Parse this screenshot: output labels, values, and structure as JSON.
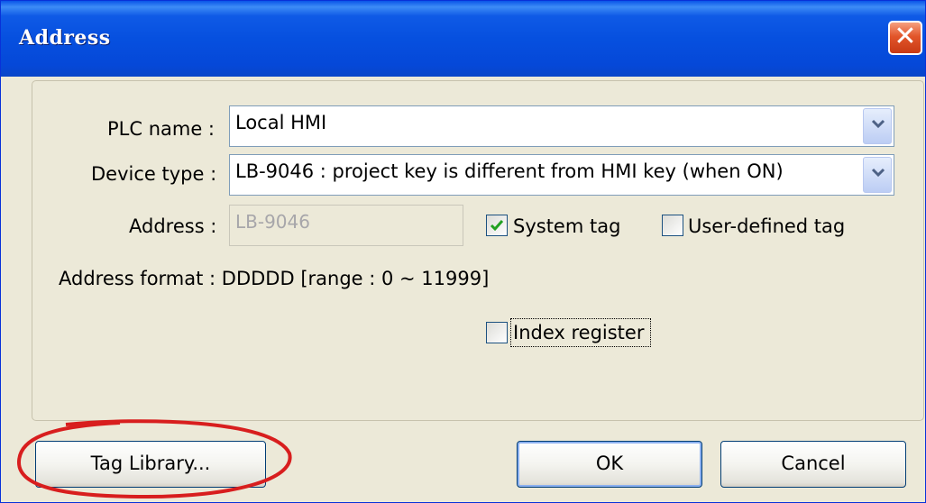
{
  "window": {
    "title": "Address",
    "close_icon": "close-icon"
  },
  "form": {
    "plc_name_label": "PLC name :",
    "plc_name_value": "Local HMI",
    "device_type_label": "Device type :",
    "device_type_value": "LB-9046 : project key is different from HMI key (when ON)",
    "address_label": "Address :",
    "address_value": "LB-9046",
    "system_tag_label": "System tag",
    "system_tag_checked": true,
    "user_defined_tag_label": "User-defined tag",
    "user_defined_tag_checked": false,
    "address_format_text": "Address format : DDDDD [range : 0 ~ 11999]",
    "index_register_label": "Index register",
    "index_register_checked": false
  },
  "buttons": {
    "tag_library": "Tag Library...",
    "ok": "OK",
    "cancel": "Cancel"
  },
  "colors": {
    "title_bar": "#0650df",
    "dialog_bg": "#ECE9D8",
    "annotation": "#d81e1e"
  }
}
